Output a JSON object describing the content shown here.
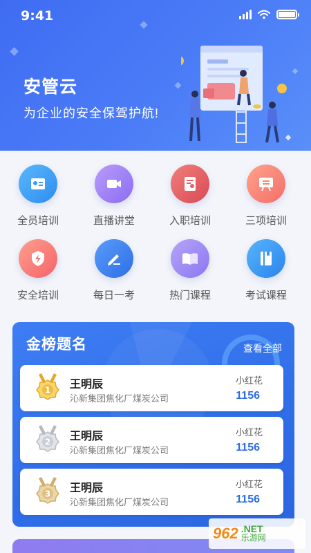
{
  "status_bar": {
    "time": "9:41"
  },
  "hero": {
    "title": "安管云",
    "subtitle": "为企业的安全保驾护航!"
  },
  "menu": [
    {
      "label": "全员培训",
      "icon": "id-card-icon",
      "color_from": "#5ab8fb",
      "color_to": "#2e8cf0"
    },
    {
      "label": "直播讲堂",
      "icon": "video-camera-icon",
      "color_from": "#b99cfb",
      "color_to": "#8b6cf2"
    },
    {
      "label": "入职培训",
      "icon": "document-person-icon",
      "color_from": "#f07f7b",
      "color_to": "#d94a55"
    },
    {
      "label": "三项培训",
      "icon": "easel-icon",
      "color_from": "#ffa28a",
      "color_to": "#f36f6a"
    },
    {
      "label": "安全培训",
      "icon": "shield-bolt-icon",
      "color_from": "#ff9e8c",
      "color_to": "#f4646b"
    },
    {
      "label": "每日一考",
      "icon": "pencil-icon",
      "color_from": "#5a9cf9",
      "color_to": "#2d6ee7"
    },
    {
      "label": "热门课程",
      "icon": "open-book-icon",
      "color_from": "#b6a4fa",
      "color_to": "#8c77ef"
    },
    {
      "label": "考试课程",
      "icon": "book-icon",
      "color_from": "#57b5fb",
      "color_to": "#2a84ec"
    }
  ],
  "ranking": {
    "title": "金榜题名",
    "view_all": "查看全部",
    "rows": [
      {
        "rank": "1",
        "medal": "gold",
        "name": "王明辰",
        "company": "沁新集团焦化厂煤炭公司",
        "user": "小红花",
        "score": "1156"
      },
      {
        "rank": "2",
        "medal": "silver",
        "name": "王明辰",
        "company": "沁新集团焦化厂煤炭公司",
        "user": "小红花",
        "score": "1156"
      },
      {
        "rank": "3",
        "medal": "bronze",
        "name": "王明辰",
        "company": "沁新集团焦化厂煤炭公司",
        "user": "小红花",
        "score": "1156"
      }
    ]
  },
  "watermark": {
    "logo": "962",
    "net": ".NET",
    "cn": "乐游网"
  },
  "colors": {
    "primary": "#2d6be4",
    "gold": "#f2c14a",
    "silver": "#c9ccd3",
    "bronze": "#d9c08e"
  }
}
